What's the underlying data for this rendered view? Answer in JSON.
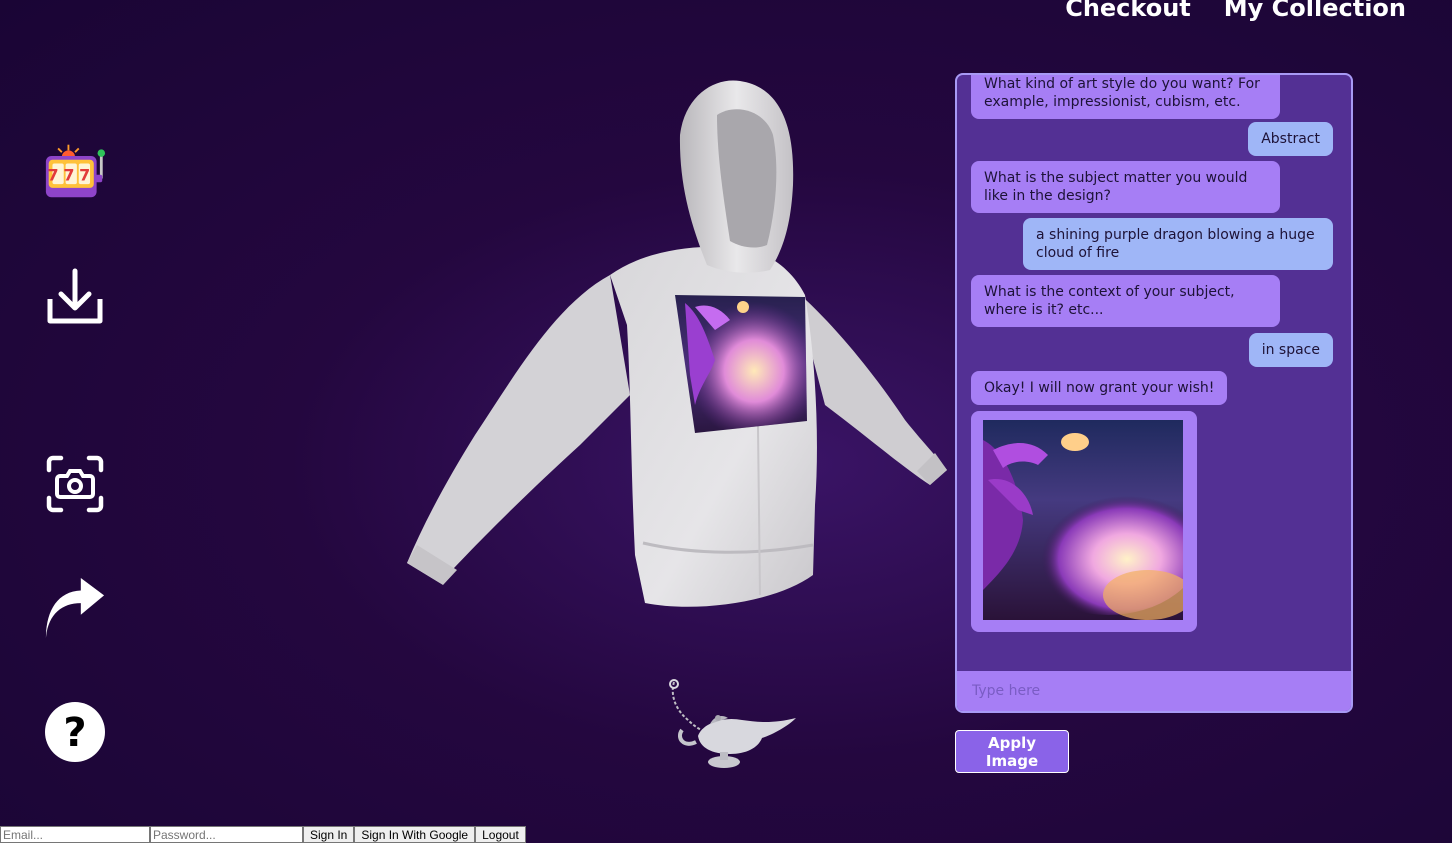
{
  "nav": {
    "checkout": "Checkout",
    "my_collection": "My Collection"
  },
  "sidebar": {
    "slot_digits": "777",
    "icons": [
      "slot-machine-icon",
      "download-icon",
      "camera-capture-icon",
      "share-icon",
      "help-icon"
    ],
    "help_glyph": "?"
  },
  "chat": {
    "messages": [
      {
        "role": "bot",
        "text": "What kind of art style do you want? For example, impressionist, cubism, etc."
      },
      {
        "role": "user",
        "text": "Abstract"
      },
      {
        "role": "bot",
        "text": "What is the subject matter you would like in the design?"
      },
      {
        "role": "user",
        "text": "a shining purple dragon blowing a huge cloud of fire"
      },
      {
        "role": "bot",
        "text": "What is the context of your subject, where is it? etc..."
      },
      {
        "role": "user",
        "text": "in space"
      },
      {
        "role": "bot",
        "text": "Okay! I will now grant your wish!"
      }
    ],
    "input_placeholder": "Type here"
  },
  "apply_label": "Apply Image",
  "auth": {
    "email_placeholder": "Email...",
    "password_placeholder": "Password...",
    "sign_in": "Sign In",
    "sign_in_google": "Sign In With Google",
    "logout": "Logout"
  },
  "colors": {
    "background": "#24073f",
    "chat_panel": "#533094",
    "bot_bubble": "#a67ef5",
    "user_bubble": "#9fb6f7",
    "accent": "#8a63e8"
  }
}
